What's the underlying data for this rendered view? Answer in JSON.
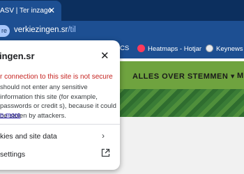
{
  "tab": {
    "title": "ASV | Ter inzage",
    "close_icon": "close-icon"
  },
  "toolbar": {
    "site_chip": "re",
    "url_host": "verkiezingen.sr",
    "url_path": "/til"
  },
  "bookmarks": [
    {
      "label": "CS",
      "icon": "bookmark-icon"
    },
    {
      "label": "Heatmaps - Hotjar",
      "icon": "hotjar-icon",
      "color": "#fd3a5c"
    },
    {
      "label": "Keynews Su",
      "icon": "globe-icon"
    }
  ],
  "site": {
    "nav_item": "ALLES OVER STEMMEN",
    "nav_item_next": "M",
    "accent": "#6fa33f"
  },
  "popup": {
    "title": "ingen.sr",
    "warning_heading": "r connection to this site is not secure",
    "warning_text": "should not enter any sensitive information this site (for example, passwords or credit s), because it could be stolen by attackers.",
    "learn_more": "n more",
    "row_cookies": "kies and site data",
    "row_settings": "settings"
  }
}
